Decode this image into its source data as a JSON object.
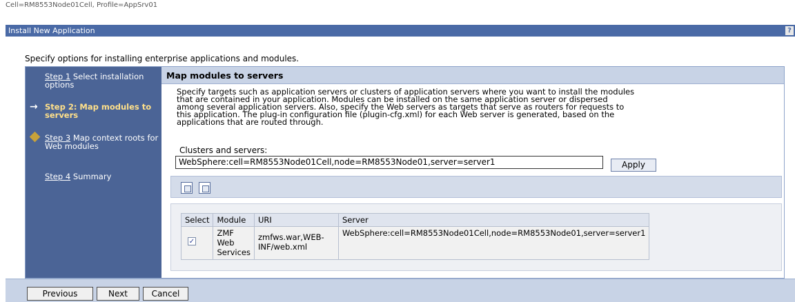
{
  "header": {
    "cell_profile": "Cell=RM8553Node01Cell, Profile=AppSrv01"
  },
  "titlebar": {
    "title": "Install New Application",
    "help": "?"
  },
  "intro": "Specify options for installing enterprise applications and modules.",
  "steps": [
    {
      "label": "Step 1",
      "text": "Select installation options"
    },
    {
      "label": "Step 2: Map modules to servers"
    },
    {
      "label": "Step 3",
      "text": "Map context roots for Web modules"
    },
    {
      "label": "Step 4",
      "text": "Summary"
    }
  ],
  "content": {
    "title": "Map modules to servers",
    "description": [
      "Specify targets such as application servers or clusters of application servers where you want to install the modules",
      "that are contained in your application. Modules can be installed on the same application server or dispersed",
      "among several application servers. Also, specify the Web servers as targets that serve as routers for requests to",
      "this application. The plug-in configuration file (plugin-cfg.xml) for each Web server is generated, based on the",
      "applications that are routed through."
    ],
    "clusters_label": "Clusters and servers:",
    "clusters_value": "WebSphere:cell=RM8553Node01Cell,node=RM8553Node01,server=server1",
    "apply_label": "Apply"
  },
  "table": {
    "headers": [
      "Select",
      "Module",
      "URI",
      "Server"
    ],
    "rows": [
      {
        "checked": "✓",
        "module": [
          "ZMF",
          "Web",
          "Services"
        ],
        "uri": [
          "zmfws.war,WEB-",
          "INF/web.xml"
        ],
        "server": "WebSphere:cell=RM8553Node01Cell,node=RM8553Node01,server=server1"
      }
    ]
  },
  "footer": {
    "previous": "Previous",
    "next": "Next",
    "cancel": "Cancel"
  }
}
